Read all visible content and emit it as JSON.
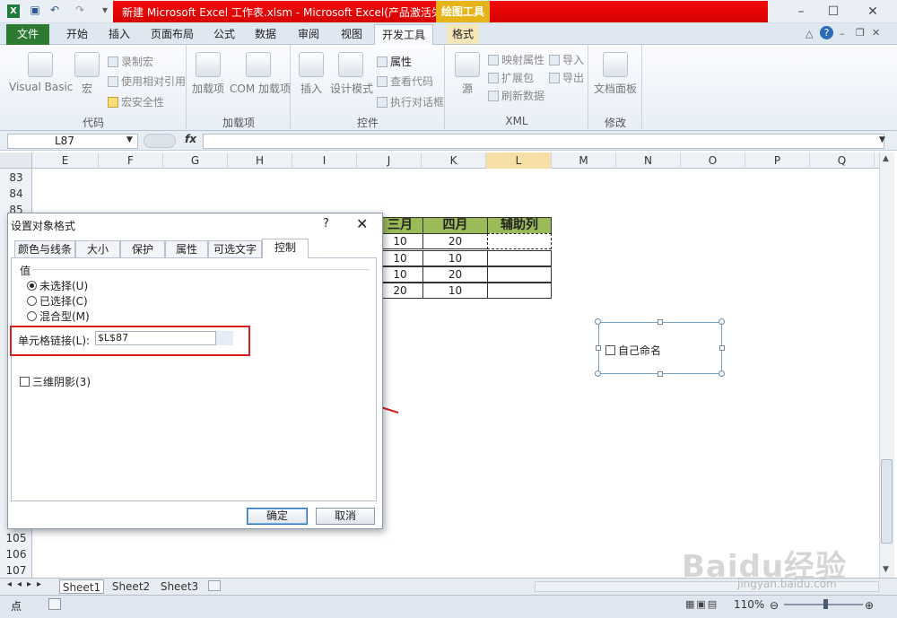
{
  "titlebar": {
    "title": "新建 Microsoft Excel 工作表.xlsm - Microsoft Excel(产品激活失败)",
    "context_tab": "绘图工具",
    "accent": "#e20505"
  },
  "tabs": [
    "文件",
    "开始",
    "插入",
    "页面布局",
    "公式",
    "数据",
    "审阅",
    "视图",
    "开发工具",
    "格式"
  ],
  "ribbon": {
    "code": {
      "label": "代码",
      "vb": "Visual Basic",
      "macro": "宏",
      "record": "录制宏",
      "relative": "使用相对引用",
      "security": "宏安全性"
    },
    "addins": {
      "label": "加载项",
      "addins": "加载项",
      "com": "COM 加载项"
    },
    "controls": {
      "label": "控件",
      "insert": "插入",
      "design": "设计模式",
      "props": "属性",
      "viewcode": "查看代码",
      "rundialog": "执行对话框"
    },
    "xml": {
      "label": "XML",
      "source": "源",
      "mapprops": "映射属性",
      "expansion": "扩展包",
      "refresh": "刷新数据",
      "import": "导入",
      "export": "导出"
    },
    "modify": {
      "label": "修改",
      "docpanel": "文档面板"
    }
  },
  "namebox": "L87",
  "fx": "fx",
  "columns": [
    "E",
    "F",
    "G",
    "H",
    "I",
    "J",
    "K",
    "L",
    "M",
    "N",
    "O",
    "P",
    "Q"
  ],
  "rows_top": [
    "83",
    "84",
    "85"
  ],
  "rows_bottom": [
    "105",
    "106",
    "107"
  ],
  "table": {
    "headers": [
      "三月",
      "四月",
      "辅助列"
    ],
    "rows": [
      [
        "10",
        "20",
        ""
      ],
      [
        "10",
        "10",
        ""
      ],
      [
        "10",
        "20",
        ""
      ],
      [
        "20",
        "10",
        ""
      ]
    ]
  },
  "checkbox_control": {
    "label": "自己命名"
  },
  "dialog": {
    "title": "设置对象格式",
    "help": "?",
    "close": "✕",
    "tabs": [
      "颜色与线条",
      "大小",
      "保护",
      "属性",
      "可选文字",
      "控制"
    ],
    "value_group": "值",
    "radios": [
      {
        "label": "未选择(U)",
        "checked": true
      },
      {
        "label": "已选择(C)",
        "checked": false
      },
      {
        "label": "混合型(M)",
        "checked": false
      }
    ],
    "cell_link_label": "单元格链接(L):",
    "cell_link_value": "$L$87",
    "shade_label": "三维阴影(3)",
    "ok": "确定",
    "cancel": "取消"
  },
  "sheets": [
    "Sheet1",
    "Sheet2",
    "Sheet3"
  ],
  "status": {
    "mode": "点",
    "zoom": "110%"
  },
  "watermark": {
    "brand": "Baidu经验",
    "url": "jingyan.baidu.com"
  }
}
